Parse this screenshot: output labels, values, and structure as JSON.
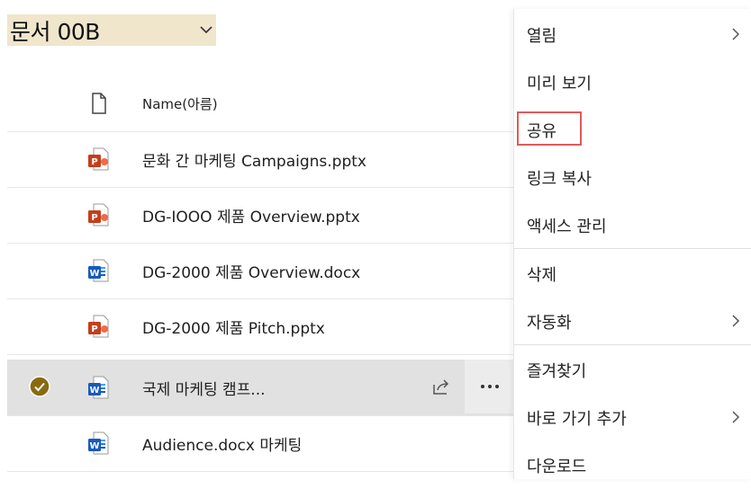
{
  "header": {
    "title": "문서 00B"
  },
  "list": {
    "column_name": "Name(아름)",
    "rows": [
      {
        "name": "문화 간 마케팅 Campaigns.pptx",
        "type": "pptx"
      },
      {
        "name": "DG-IOOO 제품 Overview.pptx",
        "type": "pptx"
      },
      {
        "name": "DG-2000 제품 Overview.docx",
        "type": "docx"
      },
      {
        "name": "DG-2000 제품 Pitch.pptx",
        "type": "pptx"
      },
      {
        "name": "국제 마케팅 캠프...",
        "type": "docx",
        "selected": true
      },
      {
        "name": "Audience.docx 마케팅",
        "type": "docx"
      }
    ]
  },
  "menu": {
    "items": [
      {
        "label": "열림",
        "submenu": true
      },
      {
        "label": "미리 보기",
        "submenu": false
      },
      {
        "label": "공유",
        "submenu": false,
        "highlighted": true
      },
      {
        "label": "링크 복사",
        "submenu": false
      },
      {
        "label": "액세스 관리",
        "submenu": false
      },
      {
        "label": "삭제",
        "submenu": false
      },
      {
        "label": "자동화",
        "submenu": true
      },
      {
        "label": "즐겨찾기",
        "submenu": false
      },
      {
        "label": "바로 가기 추가",
        "submenu": true
      },
      {
        "label": "다운로드",
        "submenu": false
      }
    ]
  },
  "colors": {
    "title_bg": "#f0e6cc",
    "selected_row": "#e1e1e1",
    "check_gold": "#8a6a10",
    "ppt_red": "#c43e1c",
    "word_blue": "#185abd",
    "highlight_red": "#e05a5a"
  },
  "icons": {
    "file_header": "file-icon",
    "share": "share-icon",
    "more": "more-icon",
    "chevron": "chevron-down-icon",
    "submenu": "chevron-right-icon"
  }
}
